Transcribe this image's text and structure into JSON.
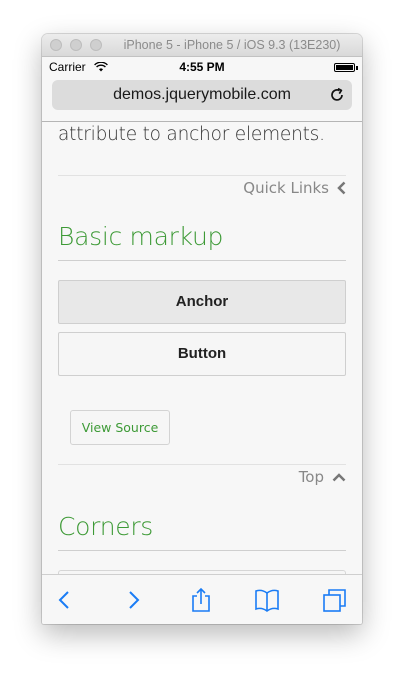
{
  "window": {
    "title": "iPhone 5 - iPhone 5 / iOS 9.3 (13E230)"
  },
  "status_bar": {
    "carrier": "Carrier",
    "time": "4:55 PM"
  },
  "url_bar": {
    "url": "demos.jquerymobile.com"
  },
  "content": {
    "intro_text": "attribute to anchor elements.",
    "quick_links": "Quick Links",
    "section_basic": "Basic markup",
    "anchor_button": "Anchor",
    "button_button": "Button",
    "view_source": "View Source",
    "top_link": "Top",
    "section_corners": "Corners"
  },
  "icons": {
    "quick_links": "chevron-left-icon",
    "top": "chevron-up-icon",
    "back": "back-arrow-icon",
    "forward": "forward-arrow-icon",
    "share": "share-icon",
    "bookmarks": "bookmarks-icon",
    "tabs": "tabs-icon"
  },
  "colors": {
    "accent_green": "#3d9a36",
    "ios_blue": "#1a7cf5"
  }
}
